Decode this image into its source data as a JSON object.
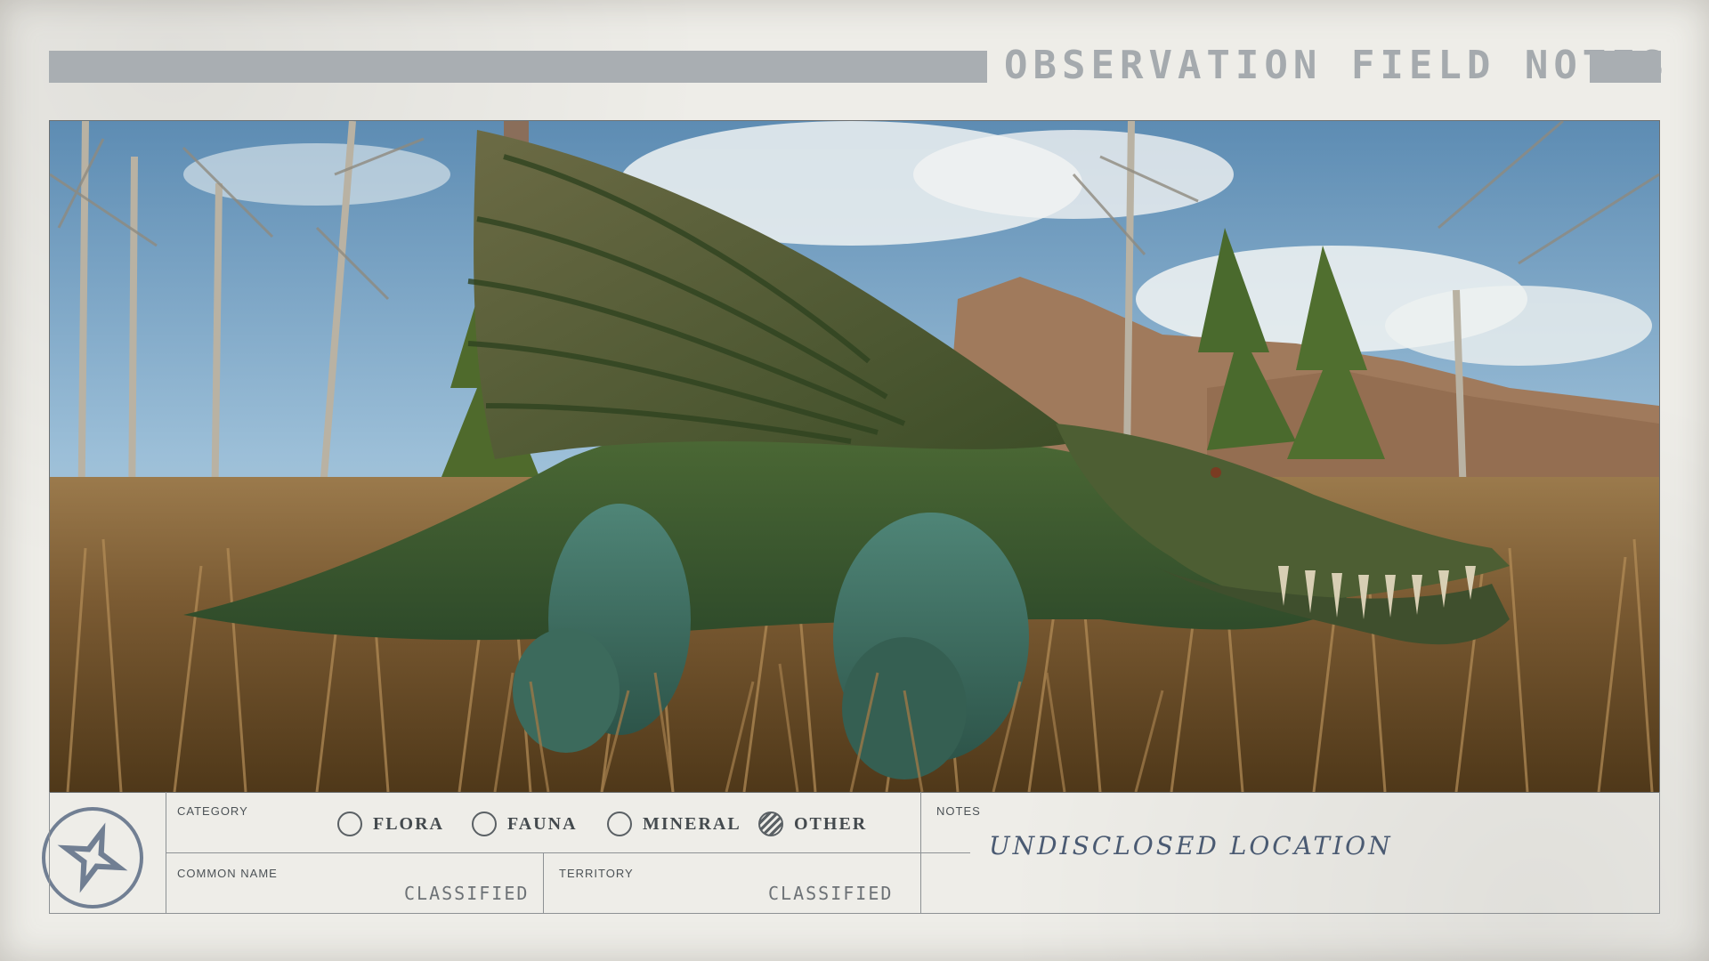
{
  "header": {
    "title": "OBSERVATION FIELD NOTES"
  },
  "photo": {
    "subject": "green finned reptilian creature in tall dry grass"
  },
  "form": {
    "category": {
      "label": "CATEGORY",
      "options": [
        {
          "label": "FLORA",
          "checked": false
        },
        {
          "label": "FAUNA",
          "checked": false
        },
        {
          "label": "MINERAL",
          "checked": false
        },
        {
          "label": "OTHER",
          "checked": true
        }
      ]
    },
    "common_name": {
      "label": "COMMON NAME",
      "value": "CLASSIFIED"
    },
    "territory": {
      "label": "TERRITORY",
      "value": "CLASSIFIED"
    },
    "notes": {
      "label": "NOTES",
      "value": "UNDISCLOSED LOCATION"
    }
  },
  "colors": {
    "paper": "#eeede8",
    "header_bar": "#a9aeb2",
    "ink": "#4c5256",
    "handwriting": "#4a5a72"
  },
  "icons": {
    "emblem": "four-point-star-emblem-icon"
  }
}
